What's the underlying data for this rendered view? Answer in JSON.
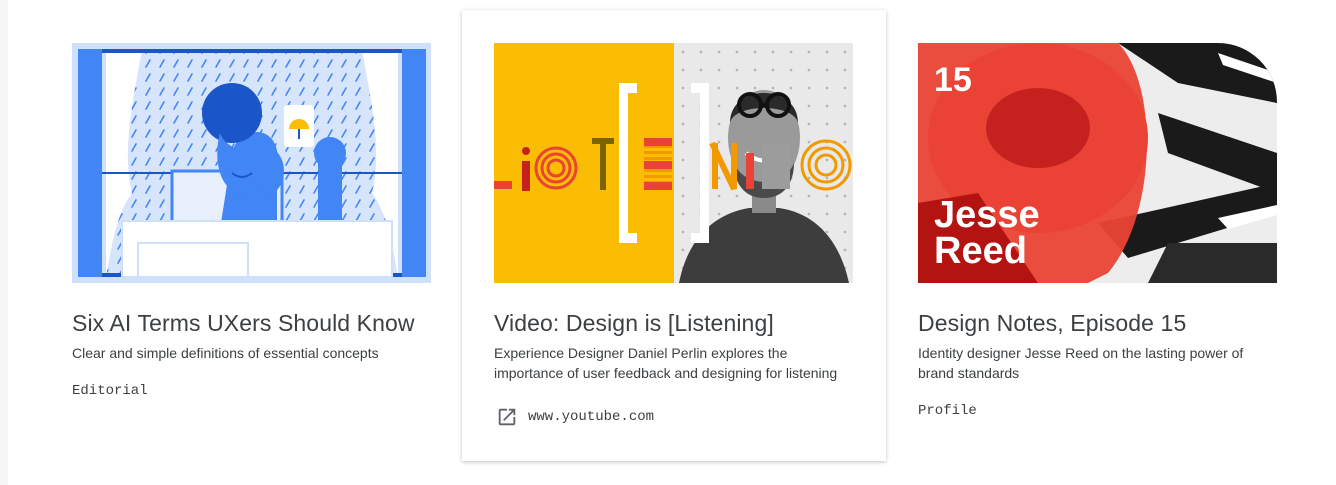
{
  "cards": [
    {
      "title": "Six AI Terms UXers Should Know",
      "description": "Clear and simple definitions of essential concepts",
      "tag": "Editorial",
      "image_icon": "illustration-person-window"
    },
    {
      "title": "Video: Design is [Listening]",
      "description": "Experience Designer Daniel Perlin explores the importance of user feedback and designing for listening",
      "link_text": "www.youtube.com",
      "link_icon": "open-in-new-icon",
      "image_icon": "listening-video-thumbnail"
    },
    {
      "title": "Design Notes, Episode 15",
      "description": "Identity designer Jesse Reed on the lasting power of brand standards",
      "tag": "Profile",
      "thumb_number": "15",
      "thumb_name_line1": "Jesse",
      "thumb_name_line2": "Reed",
      "image_icon": "design-notes-thumbnail"
    }
  ],
  "colors": {
    "text": "#3c4043",
    "blue": "#4285f4",
    "yellow": "#fbbc04",
    "red": "#ea4335"
  }
}
